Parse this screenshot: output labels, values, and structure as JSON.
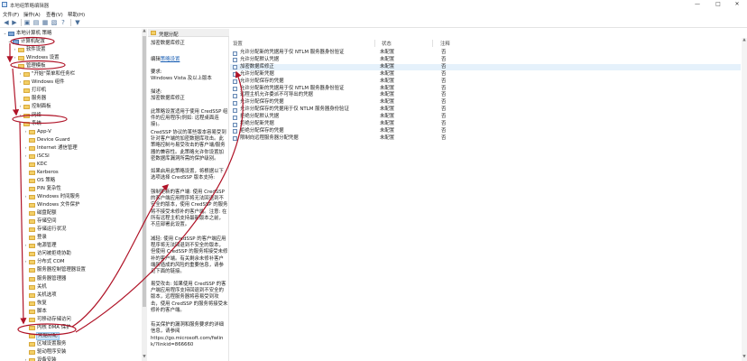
{
  "window": {
    "title": "本地组策略编辑器",
    "controls": [
      "—",
      "□",
      "✕"
    ]
  },
  "menu": [
    "文件(F)",
    "操作(A)",
    "查看(V)",
    "帮助(H)"
  ],
  "toolbar_icons": [
    "back-icon",
    "forward-icon",
    "up-icon",
    "show-hide-tree-icon",
    "properties-icon",
    "export-icon",
    "help-icon",
    "filter-icon"
  ],
  "tree": [
    {
      "label": "本地计算机 策略",
      "expander": "⌄",
      "icon": "pc"
    },
    {
      "label": "计算机配置",
      "expander": "⌄",
      "icon": "pc"
    },
    {
      "label": "软件设置",
      "expander": "›",
      "icon": "folder"
    },
    {
      "label": "Windows 设置",
      "expander": "›",
      "icon": "folder"
    },
    {
      "label": "管理模板",
      "expander": "⌄",
      "icon": "folder"
    },
    {
      "label": "\"开始\"菜单和任务栏",
      "expander": "›",
      "icon": "folder"
    },
    {
      "label": "Windows 组件",
      "expander": "›",
      "icon": "folder"
    },
    {
      "label": "打印机",
      "expander": "",
      "icon": "folder"
    },
    {
      "label": "服务器",
      "expander": "",
      "icon": "folder"
    },
    {
      "label": "控制面板",
      "expander": "›",
      "icon": "folder"
    },
    {
      "label": "网络",
      "expander": "›",
      "icon": "folder"
    },
    {
      "label": "系统",
      "expander": "⌄",
      "icon": "folder"
    },
    {
      "label": "App-V",
      "expander": "›",
      "icon": "folder"
    },
    {
      "label": "Device Guard",
      "expander": "",
      "icon": "folder"
    },
    {
      "label": "Internet 通信管理",
      "expander": "›",
      "icon": "folder"
    },
    {
      "label": "iSCSI",
      "expander": "›",
      "icon": "folder"
    },
    {
      "label": "KDC",
      "expander": "",
      "icon": "folder"
    },
    {
      "label": "Kerberos",
      "expander": "",
      "icon": "folder"
    },
    {
      "label": "OS 策略",
      "expander": "",
      "icon": "folder"
    },
    {
      "label": "PIN 复杂性",
      "expander": "",
      "icon": "folder"
    },
    {
      "label": "Windows 时间服务",
      "expander": "›",
      "icon": "folder"
    },
    {
      "label": "Windows 文件保护",
      "expander": "",
      "icon": "folder"
    },
    {
      "label": "磁盘配额",
      "expander": "",
      "icon": "folder"
    },
    {
      "label": "存储空间",
      "expander": "",
      "icon": "folder"
    },
    {
      "label": "存储运行状况",
      "expander": "",
      "icon": "folder"
    },
    {
      "label": "登录",
      "expander": "",
      "icon": "folder"
    },
    {
      "label": "电源管理",
      "expander": "›",
      "icon": "folder"
    },
    {
      "label": "访问被拒绝协助",
      "expander": "",
      "icon": "folder"
    },
    {
      "label": "分布式 COM",
      "expander": "›",
      "icon": "folder"
    },
    {
      "label": "服务器控制管理器设置",
      "expander": "",
      "icon": "folder"
    },
    {
      "label": "服务器管理器",
      "expander": "",
      "icon": "folder"
    },
    {
      "label": "关机",
      "expander": "",
      "icon": "folder"
    },
    {
      "label": "关机选项",
      "expander": "",
      "icon": "folder"
    },
    {
      "label": "恢复",
      "expander": "",
      "icon": "folder"
    },
    {
      "label": "脚本",
      "expander": "",
      "icon": "folder"
    },
    {
      "label": "可移动存储访问",
      "expander": "",
      "icon": "folder"
    },
    {
      "label": "内核 DMA 保护",
      "expander": "",
      "icon": "folder"
    },
    {
      "label": "凭据分配",
      "expander": "",
      "icon": "folder"
    },
    {
      "label": "区域设置服务",
      "expander": "",
      "icon": "folder"
    },
    {
      "label": "驱动程序安装",
      "expander": "",
      "icon": "folder"
    },
    {
      "label": "设备安装",
      "expander": "›",
      "icon": "folder"
    }
  ],
  "selected_node": "凭据分配",
  "description": {
    "header": "凭据分配",
    "policy_title": "加密数据库修正",
    "edit_prefix": "编辑",
    "edit_link": "策略设置",
    "req_label": "要求:",
    "req_text": "Windows Vista 及以上版本",
    "desc_label": "描述:",
    "desc_text": "加密数据库修正",
    "body": [
      "此策略设置适用于使用 CredSSP 组件的应用程序(例如: 远程桌面连接)。",
      "CredSSP 协议的某些版本容易受到针对客户端的加密数据库攻击。此策略控制与易受攻击的客户端/服务器的兼容性。此策略允许你设置加密数据库漏洞所需的保护级别。",
      "如果启用此策略设置，将根据以下选项选择 CredSSP 版本支持:",
      "强制更新的客户端: 使用 CredSSP 的客户端应用程序将无法回退到不安全的版本，使用 CredSSP 的服务将不接受未修补的客户端。注意: 在所有远程主机支持最新版本之前，不应部署此设置。",
      "减轻: 使用 CredSSP 的客户端应用程序将无法回退到不安全的版本，但使用 CredSSP 的服务将接受未修补的客户端。有关剩余未修补客户端所造成的风险的重要信息，请参见下面的链接。",
      "易受攻击: 如果使用 CredSSP 的客户端应用程序支持回退到不安全的版本，远程服务器将容易受到攻击，使用 CredSSP 的服务将接受未修补的客户端。",
      "有关保护的漏洞和服务要求的详细信息，请参阅",
      "https://go.microsoft.com/fwlink/?linkid=866660"
    ]
  },
  "columns": {
    "setting": "设置",
    "state": "状态",
    "comment": "注释"
  },
  "policies": [
    {
      "name": "允许分配新的凭据用于仅 NTLM 服务器身份验证",
      "state": "未配置",
      "comment": "否"
    },
    {
      "name": "允许分配默认凭据",
      "state": "未配置",
      "comment": "否"
    },
    {
      "name": "加密数据库修正",
      "state": "未配置",
      "comment": "否"
    },
    {
      "name": "允许分配新凭据",
      "state": "未配置",
      "comment": "否"
    },
    {
      "name": "允许分配保存的凭据",
      "state": "未配置",
      "comment": "否"
    },
    {
      "name": "允许分配新的凭据用于仅 NTLM 服务器身份验证",
      "state": "未配置",
      "comment": "否"
    },
    {
      "name": "远程主机允许委派不可导出的凭据",
      "state": "未配置",
      "comment": "否"
    },
    {
      "name": "允许分配保存的凭据",
      "state": "未配置",
      "comment": "否"
    },
    {
      "name": "允许分配保存的凭据用于仅 NTLM 服务器身份验证",
      "state": "未配置",
      "comment": "否"
    },
    {
      "name": "拒绝分配默认凭据",
      "state": "未配置",
      "comment": "否"
    },
    {
      "name": "拒绝分配新凭据",
      "state": "未配置",
      "comment": "否"
    },
    {
      "name": "拒绝分配保存的凭据",
      "state": "未配置",
      "comment": "否"
    },
    {
      "name": "限制向远程服务器分配凭据",
      "state": "未配置",
      "comment": "否"
    }
  ],
  "annotation_color": "#b01428"
}
